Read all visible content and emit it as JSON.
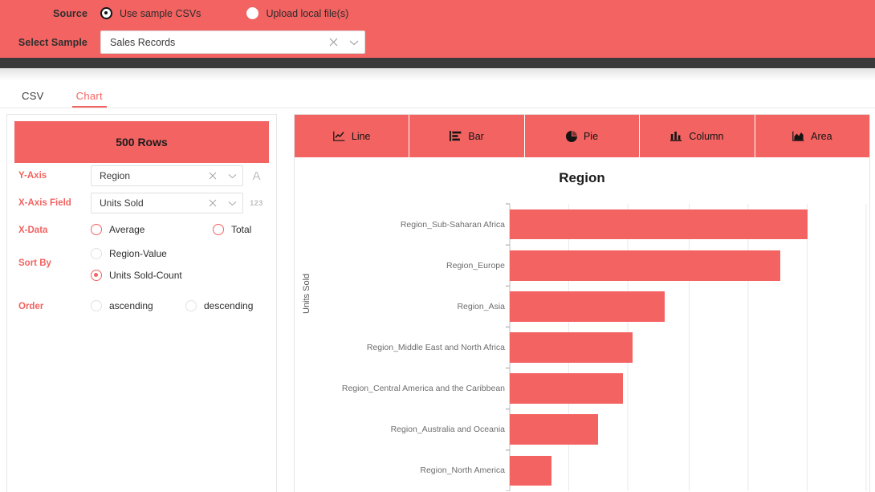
{
  "header": {
    "source_label": "Source",
    "source_options": [
      {
        "label": "Use sample CSVs",
        "selected": true
      },
      {
        "label": "Upload local file(s)",
        "selected": false
      }
    ],
    "select_sample_label": "Select Sample",
    "select_sample_value": "Sales Records",
    "clear_icon": "close-icon",
    "dropdown_icon": "chevron-down-icon"
  },
  "tabs": [
    {
      "label": "CSV",
      "active": false
    },
    {
      "label": "Chart",
      "active": true
    }
  ],
  "left_panel": {
    "rows_button": "500 Rows",
    "y_axis": {
      "label": "Y-Axis",
      "value": "Region",
      "type_indicator": "A"
    },
    "x_axis_field": {
      "label": "X-Axis Field",
      "value": "Units Sold",
      "type_indicator": "123"
    },
    "x_data": {
      "label": "X-Data",
      "options": [
        {
          "label": "Average",
          "state": "highlight"
        },
        {
          "label": "Total",
          "state": "highlight"
        }
      ]
    },
    "sort_by": {
      "label": "Sort By",
      "options": [
        {
          "label": "Region-Value",
          "state": "off"
        },
        {
          "label": "Units Sold-Count",
          "state": "on"
        }
      ]
    },
    "order": {
      "label": "Order",
      "options": [
        {
          "label": "ascending",
          "state": "off"
        },
        {
          "label": "descending",
          "state": "off"
        }
      ]
    }
  },
  "chart_toolbar": [
    {
      "label": "Line",
      "icon": "line-chart-icon"
    },
    {
      "label": "Bar",
      "icon": "bar-chart-icon"
    },
    {
      "label": "Pie",
      "icon": "pie-chart-icon"
    },
    {
      "label": "Column",
      "icon": "column-chart-icon"
    },
    {
      "label": "Area",
      "icon": "area-chart-icon"
    }
  ],
  "colors": {
    "accent": "#F26361",
    "bar": "#F26361",
    "dark_strip": "#3A3A3A",
    "grid": "#E8EAF0"
  },
  "chart_data": {
    "type": "bar",
    "title": "Region",
    "xlabel": "",
    "ylabel": "Units Sold",
    "orientation": "horizontal",
    "grid": true,
    "legend": "none",
    "categories": [
      "Region_Sub-Saharan Africa",
      "Region_Europe",
      "Region_Asia",
      "Region_Middle East and North Africa",
      "Region_Central America and the Caribbean",
      "Region_Australia and Oceania",
      "Region_North America"
    ],
    "values": [
      121,
      110,
      63,
      50,
      46,
      36,
      17
    ],
    "xlim": [
      0,
      145
    ],
    "gridline_values": [
      24,
      48,
      73,
      97,
      121,
      145
    ]
  }
}
